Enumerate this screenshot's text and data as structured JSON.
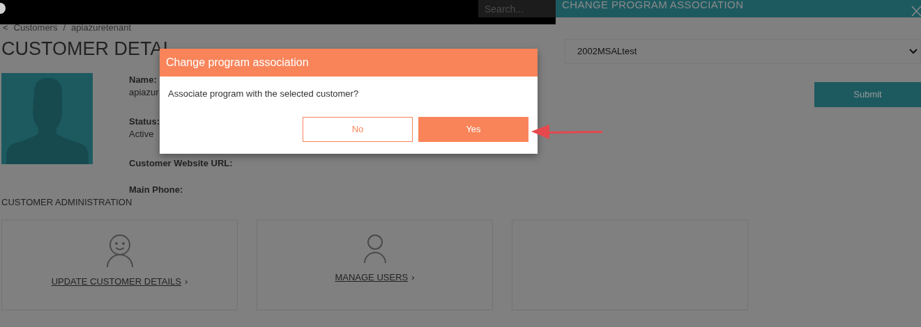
{
  "top_bar": {
    "search": {
      "placeholder": "Search..."
    }
  },
  "breadcrumb": {
    "back": "<",
    "items": [
      "Customers",
      "apiazuretenant"
    ],
    "separator": "/"
  },
  "page_title": "CUSTOMER DETAI",
  "fields": [
    {
      "label": "Name:",
      "value": "apiazur"
    },
    {
      "label": "Status:",
      "value": "Active"
    },
    {
      "label": "Customer Website URL:"
    },
    {
      "label": "Main Phone:"
    }
  ],
  "section_title": "CUSTOMER ADMINISTRATION",
  "cards": [
    {
      "kind": "smile",
      "link": "UPDATE CUSTOMER DETAILS",
      "chevron": "›"
    },
    {
      "kind": "user",
      "link": "MANAGE USERS",
      "chevron": "›"
    },
    {
      "kind": "empty"
    }
  ],
  "side_panel": {
    "title": "CHANGE PROGRAM ASSOCIATION",
    "program": "2002MSALtest",
    "submit": "Submit"
  },
  "dialog": {
    "title": "Change program association",
    "message": "Associate program with the selected customer?",
    "buttons": [
      {
        "label": "No",
        "kind": "secondary"
      },
      {
        "label": "Yes",
        "kind": "primary"
      }
    ]
  }
}
